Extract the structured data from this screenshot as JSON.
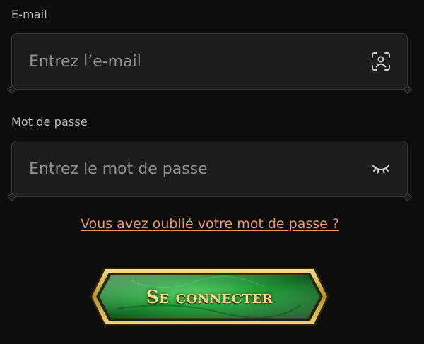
{
  "form": {
    "email": {
      "label": "E-mail",
      "placeholder": "Entrez l’e-mail",
      "value": "",
      "icon": "face-id-icon"
    },
    "password": {
      "label": "Mot de passe",
      "placeholder": "Entrez le mot de passe",
      "value": "",
      "icon": "eye-closed-icon"
    },
    "forgot_link": "Vous avez oublié votre mot de passe ?",
    "submit_label": "Se connecter"
  },
  "colors": {
    "background": "#0e0d0e",
    "field_background": "#1c1c1c",
    "link": "#e79b6d",
    "button_green": "#1f8a2e",
    "button_gold": "#d9b45a",
    "button_text": "#f3dd86"
  }
}
